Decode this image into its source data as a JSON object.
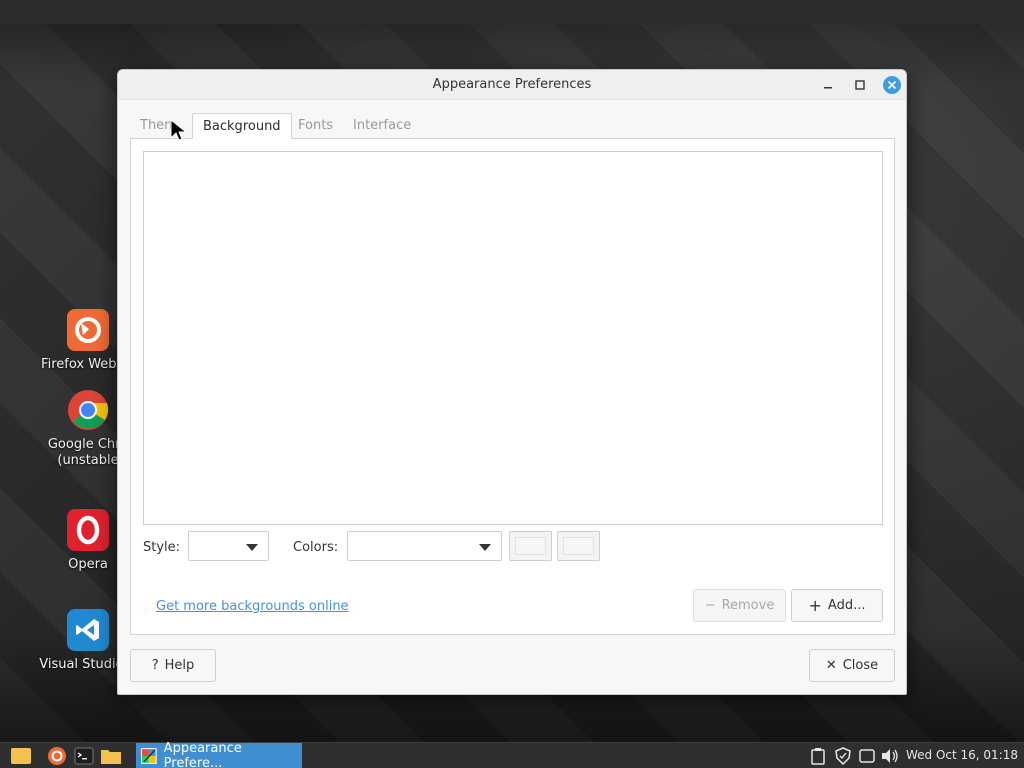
{
  "desktop": {
    "icons": [
      {
        "name": "desktop-icon-firefox",
        "label": "Firefox Web Br"
      },
      {
        "name": "desktop-icon-chrome",
        "label": "Google Chro",
        "label2": "(unstable"
      },
      {
        "name": "desktop-icon-opera",
        "label": "Opera"
      },
      {
        "name": "desktop-icon-vscode",
        "label": "Visual Studio C"
      }
    ]
  },
  "window": {
    "title": "Appearance Preferences",
    "tabs": [
      {
        "label": "Them",
        "active": false
      },
      {
        "label": "Background",
        "active": true
      },
      {
        "label": "Fonts",
        "active": false
      },
      {
        "label": "Interface",
        "active": false
      }
    ],
    "style_label": "Style:",
    "style_value": "",
    "colors_label": "Colors:",
    "colors_value": "",
    "online_link": "Get more backgrounds online",
    "remove_button": "Remove",
    "add_button": "Add...",
    "help_button": "Help",
    "close_button": "Close"
  },
  "taskbar": {
    "active_task": "Appearance Prefere...",
    "clock": "Wed Oct 16, 01:18"
  },
  "colors": {
    "accent": "#3e8ed0",
    "link": "#4a90d9",
    "close_button": "#3d9ee0"
  }
}
